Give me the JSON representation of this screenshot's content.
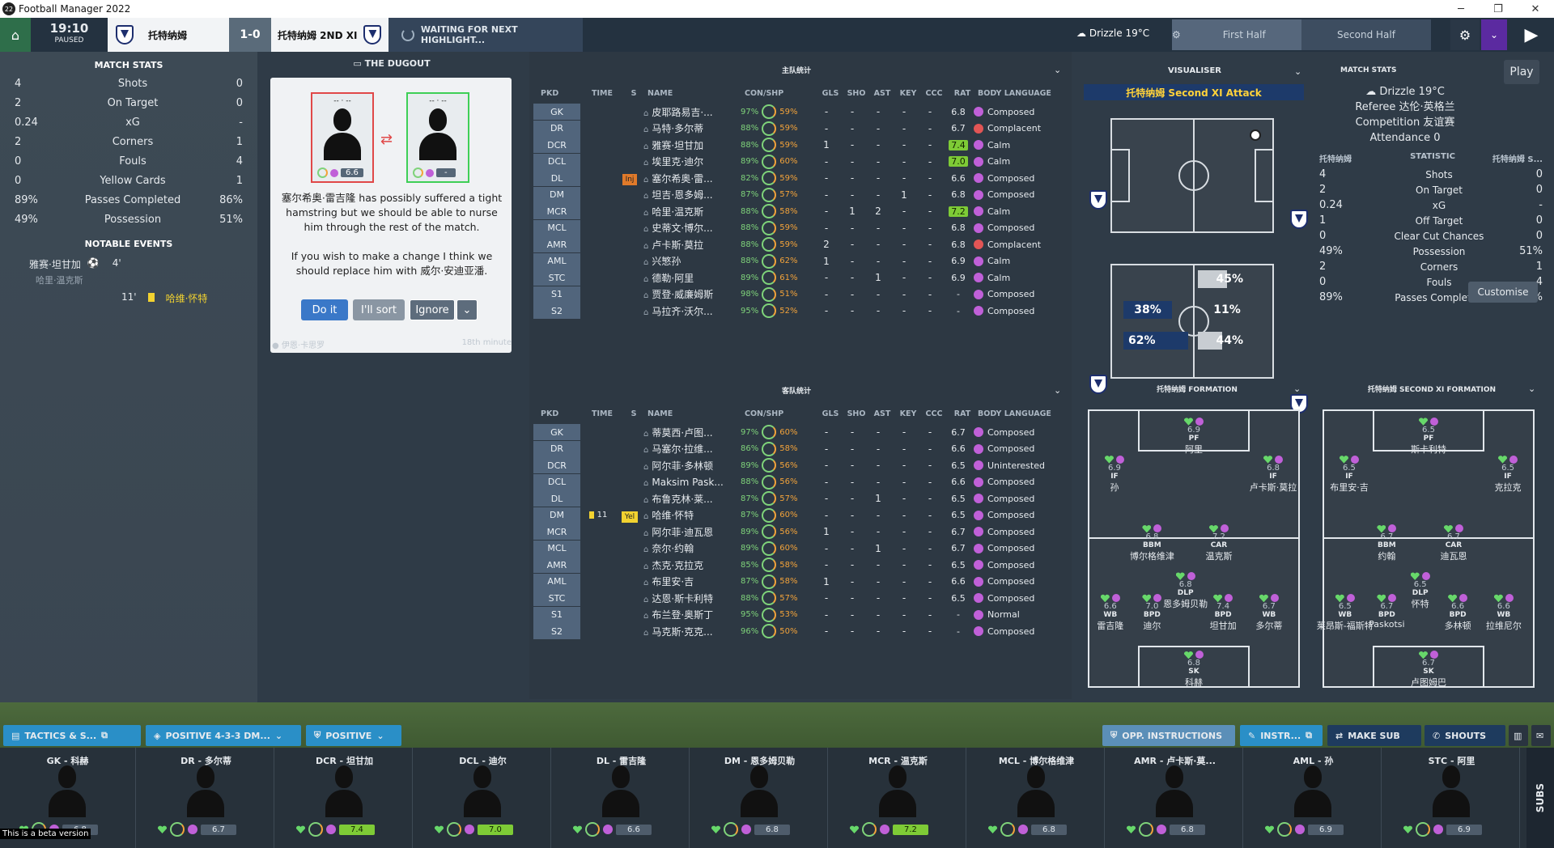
{
  "window": {
    "title": "Football Manager 2022",
    "logo": "22"
  },
  "header": {
    "time": "19:10",
    "status": "PAUSED",
    "home_team": "托特纳姆",
    "score": "1-0",
    "away_team": "托特纳姆 2ND XI",
    "waiting": "WAITING FOR NEXT HIGHLIGHT...",
    "weather": "Drizzle 19°C",
    "first_half": "First Half",
    "second_half": "Second Half"
  },
  "left_stats": {
    "title": "MATCH STATS",
    "rows": [
      {
        "a": "4",
        "label": "Shots",
        "b": "0"
      },
      {
        "a": "2",
        "label": "On Target",
        "b": "0"
      },
      {
        "a": "0.24",
        "label": "xG",
        "b": "-"
      },
      {
        "a": "2",
        "label": "Corners",
        "b": "1"
      },
      {
        "a": "0",
        "label": "Fouls",
        "b": "4"
      },
      {
        "a": "0",
        "label": "Yellow Cards",
        "b": "1"
      },
      {
        "a": "89%",
        "label": "Passes Completed",
        "b": "86%"
      },
      {
        "a": "49%",
        "label": "Possession",
        "b": "51%"
      }
    ],
    "events_title": "NOTABLE EVENTS",
    "event1_player": "雅赛·坦甘加",
    "event1_minute": "4'",
    "event1_assist": "哈里·温克斯",
    "event2_minute": "11'",
    "event2_player": "哈维·怀特"
  },
  "dugout": {
    "title": "THE DUGOUT",
    "tile1_rating": "6.6",
    "tile2_rating": "-",
    "message1": "塞尔希奥·雷吉隆 has possibly suffered a tight hamstring but we should be able to nurse him through the rest of the match.",
    "message2": "If you wish to make a change I think we should replace him with 威尔·安迪亚潘.",
    "do_it": "Do it",
    "ill_sort": "I'll sort",
    "ignore": "Ignore",
    "from": "伊恩·卡思罗",
    "minute": "18th minute"
  },
  "squad1": {
    "title": "主队统计",
    "headers": {
      "pkd": "PKD",
      "time": "TIME",
      "s": "S",
      "name": "NAME",
      "con": "CON/SHP",
      "gls": "GLS",
      "sho": "SHO",
      "ast": "AST",
      "key": "KEY",
      "ccc": "CCC",
      "rat": "RAT",
      "bl": "BODY LANGUAGE"
    },
    "rows": [
      {
        "pos": "GK",
        "name": "皮耶路易吉·...",
        "con": "97%",
        "shp": "59%",
        "gls": "-",
        "sho": "-",
        "ast": "-",
        "key": "-",
        "ccc": "-",
        "rat": "6.8",
        "bl": "Composed"
      },
      {
        "pos": "DR",
        "name": "马特·多尔蒂",
        "con": "88%",
        "shp": "59%",
        "gls": "-",
        "sho": "-",
        "ast": "-",
        "key": "-",
        "ccc": "-",
        "rat": "6.7",
        "bl": "Complacent"
      },
      {
        "pos": "DCR",
        "name": "雅赛·坦甘加",
        "con": "88%",
        "shp": "59%",
        "gls": "1",
        "sho": "-",
        "ast": "-",
        "key": "-",
        "ccc": "-",
        "rat": "7.4",
        "bl": "Calm"
      },
      {
        "pos": "DCL",
        "name": "埃里克·迪尔",
        "con": "89%",
        "shp": "60%",
        "gls": "-",
        "sho": "-",
        "ast": "-",
        "key": "-",
        "ccc": "-",
        "rat": "7.0",
        "bl": "Calm"
      },
      {
        "pos": "DL",
        "name": "塞尔希奥·雷...",
        "con": "82%",
        "shp": "59%",
        "gls": "-",
        "sho": "-",
        "ast": "-",
        "key": "-",
        "ccc": "-",
        "rat": "6.6",
        "bl": "Composed",
        "tag": "Inj"
      },
      {
        "pos": "DM",
        "name": "坦吉·恩多姆...",
        "con": "87%",
        "shp": "57%",
        "gls": "-",
        "sho": "-",
        "ast": "-",
        "key": "1",
        "ccc": "-",
        "rat": "6.8",
        "bl": "Composed"
      },
      {
        "pos": "MCR",
        "name": "哈里·温克斯",
        "con": "88%",
        "shp": "58%",
        "gls": "-",
        "sho": "1",
        "ast": "2",
        "key": "-",
        "ccc": "-",
        "rat": "7.2",
        "bl": "Calm"
      },
      {
        "pos": "MCL",
        "name": "史蒂文·博尔...",
        "con": "88%",
        "shp": "59%",
        "gls": "-",
        "sho": "-",
        "ast": "-",
        "key": "-",
        "ccc": "-",
        "rat": "6.8",
        "bl": "Composed"
      },
      {
        "pos": "AMR",
        "name": "卢卡斯·莫拉",
        "con": "88%",
        "shp": "59%",
        "gls": "2",
        "sho": "-",
        "ast": "-",
        "key": "-",
        "ccc": "-",
        "rat": "6.8",
        "bl": "Complacent"
      },
      {
        "pos": "AML",
        "name": "兴慜孙",
        "con": "88%",
        "shp": "62%",
        "gls": "1",
        "sho": "-",
        "ast": "-",
        "key": "-",
        "ccc": "-",
        "rat": "6.9",
        "bl": "Calm"
      },
      {
        "pos": "STC",
        "name": "德勒·阿里",
        "con": "89%",
        "shp": "61%",
        "gls": "-",
        "sho": "-",
        "ast": "1",
        "key": "-",
        "ccc": "-",
        "rat": "6.9",
        "bl": "Calm"
      },
      {
        "pos": "S1",
        "name": "贾登·威廉姆斯",
        "con": "98%",
        "shp": "51%",
        "gls": "-",
        "sho": "-",
        "ast": "-",
        "key": "-",
        "ccc": "-",
        "rat": "-",
        "bl": "Composed"
      },
      {
        "pos": "S2",
        "name": "马拉齐·沃尔...",
        "con": "95%",
        "shp": "52%",
        "gls": "-",
        "sho": "-",
        "ast": "-",
        "key": "-",
        "ccc": "-",
        "rat": "-",
        "bl": "Composed"
      }
    ]
  },
  "squad2": {
    "title": "客队统计",
    "rows": [
      {
        "pos": "GK",
        "name": "蒂莫西·卢图...",
        "con": "97%",
        "shp": "60%",
        "gls": "-",
        "sho": "-",
        "ast": "-",
        "key": "-",
        "ccc": "-",
        "rat": "6.7",
        "bl": "Composed"
      },
      {
        "pos": "DR",
        "name": "马塞尔·拉维...",
        "con": "86%",
        "shp": "58%",
        "gls": "-",
        "sho": "-",
        "ast": "-",
        "key": "-",
        "ccc": "-",
        "rat": "6.6",
        "bl": "Composed"
      },
      {
        "pos": "DCR",
        "name": "阿尔菲·多林顿",
        "con": "89%",
        "shp": "56%",
        "gls": "-",
        "sho": "-",
        "ast": "-",
        "key": "-",
        "ccc": "-",
        "rat": "6.5",
        "bl": "Uninterested"
      },
      {
        "pos": "DCL",
        "name": "Maksim Pask...",
        "con": "88%",
        "shp": "56%",
        "gls": "-",
        "sho": "-",
        "ast": "-",
        "key": "-",
        "ccc": "-",
        "rat": "6.6",
        "bl": "Composed"
      },
      {
        "pos": "DL",
        "name": "布鲁克林·莱...",
        "con": "87%",
        "shp": "57%",
        "gls": "-",
        "sho": "-",
        "ast": "1",
        "key": "-",
        "ccc": "-",
        "rat": "6.5",
        "bl": "Composed"
      },
      {
        "pos": "DM",
        "name": "哈维·怀特",
        "con": "87%",
        "shp": "60%",
        "gls": "-",
        "sho": "-",
        "ast": "-",
        "key": "-",
        "ccc": "-",
        "rat": "6.5",
        "bl": "Composed",
        "time": "11",
        "tag": "Yel"
      },
      {
        "pos": "MCR",
        "name": "阿尔菲·迪瓦恩",
        "con": "89%",
        "shp": "56%",
        "gls": "1",
        "sho": "-",
        "ast": "-",
        "key": "-",
        "ccc": "-",
        "rat": "6.7",
        "bl": "Composed"
      },
      {
        "pos": "MCL",
        "name": "奈尔·约翰",
        "con": "89%",
        "shp": "60%",
        "gls": "-",
        "sho": "-",
        "ast": "1",
        "key": "-",
        "ccc": "-",
        "rat": "6.7",
        "bl": "Composed"
      },
      {
        "pos": "AMR",
        "name": "杰克·克拉克",
        "con": "85%",
        "shp": "58%",
        "gls": "-",
        "sho": "-",
        "ast": "-",
        "key": "-",
        "ccc": "-",
        "rat": "6.5",
        "bl": "Composed"
      },
      {
        "pos": "AML",
        "name": "布里安·吉",
        "con": "87%",
        "shp": "58%",
        "gls": "1",
        "sho": "-",
        "ast": "-",
        "key": "-",
        "ccc": "-",
        "rat": "6.6",
        "bl": "Composed"
      },
      {
        "pos": "STC",
        "name": "达恩·斯卡利特",
        "con": "88%",
        "shp": "57%",
        "gls": "-",
        "sho": "-",
        "ast": "-",
        "key": "-",
        "ccc": "-",
        "rat": "6.5",
        "bl": "Composed"
      },
      {
        "pos": "S1",
        "name": "布兰登·奥斯丁",
        "con": "95%",
        "shp": "53%",
        "gls": "-",
        "sho": "-",
        "ast": "-",
        "key": "-",
        "ccc": "-",
        "rat": "-",
        "bl": "Normal"
      },
      {
        "pos": "S2",
        "name": "马克斯·克克...",
        "con": "96%",
        "shp": "50%",
        "gls": "-",
        "sho": "-",
        "ast": "-",
        "key": "-",
        "ccc": "-",
        "rat": "-",
        "bl": "Composed"
      }
    ]
  },
  "visualiser": {
    "title": "VISUALISER",
    "banner": "托特纳姆 Second XI Attack",
    "bar1": "45%",
    "bar2": "38%",
    "bar3": "11%",
    "bar4": "62%",
    "bar5": "44%"
  },
  "matchstats": {
    "title": "MATCH STATS",
    "play": "Play",
    "weather": "Drizzle 19°C",
    "referee": "Referee 达伦·英格兰",
    "competition": "Competition 友谊赛",
    "attendance": "Attendance 0",
    "col_home": "托特纳姆",
    "col_stat": "STATISTIC",
    "col_away": "托特纳姆 S...",
    "rows": [
      {
        "a": "4",
        "l": "Shots",
        "b": "0"
      },
      {
        "a": "2",
        "l": "On Target",
        "b": "0"
      },
      {
        "a": "0.24",
        "l": "xG",
        "b": "-"
      },
      {
        "a": "1",
        "l": "Off Target",
        "b": "0"
      },
      {
        "a": "0",
        "l": "Clear Cut Chances",
        "b": "0"
      },
      {
        "a": "49%",
        "l": "Possession",
        "b": "51%"
      },
      {
        "a": "2",
        "l": "Corners",
        "b": "1"
      },
      {
        "a": "0",
        "l": "Fouls",
        "b": "4"
      },
      {
        "a": "89%",
        "l": "Passes Completed",
        "b": "86%"
      }
    ],
    "customise": "Customise"
  },
  "formation1": {
    "title": "托特纳姆 FORMATION",
    "players": [
      {
        "name": "阿里",
        "role": "PF",
        "r": "6.9"
      },
      {
        "name": "孙",
        "role": "IF",
        "r": "6.9"
      },
      {
        "name": "卢卡斯·莫拉",
        "role": "IF",
        "r": "6.8"
      },
      {
        "name": "博尔格维津",
        "role": "BBM",
        "r": "6.8"
      },
      {
        "name": "温克斯",
        "role": "CAR",
        "r": "7.2"
      },
      {
        "name": "恩多姆贝勒",
        "role": "DLP",
        "r": "6.8"
      },
      {
        "name": "雷吉隆",
        "role": "WB",
        "r": "6.6"
      },
      {
        "name": "迪尔",
        "role": "BPD",
        "r": "7.0"
      },
      {
        "name": "坦甘加",
        "role": "BPD",
        "r": "7.4"
      },
      {
        "name": "多尔蒂",
        "role": "WB",
        "r": "6.7"
      },
      {
        "name": "科赫",
        "role": "SK",
        "r": "6.8"
      }
    ]
  },
  "formation2": {
    "title": "托特纳姆 SECOND XI FORMATION",
    "players": [
      {
        "name": "斯卡利特",
        "role": "PF",
        "r": "6.5"
      },
      {
        "name": "布里安·吉",
        "role": "IF",
        "r": "6.5"
      },
      {
        "name": "克拉克",
        "role": "IF",
        "r": "6.5"
      },
      {
        "name": "约翰",
        "role": "BBM",
        "r": "6.7"
      },
      {
        "name": "迪瓦恩",
        "role": "CAR",
        "r": "6.7"
      },
      {
        "name": "怀特",
        "role": "DLP",
        "r": "6.5"
      },
      {
        "name": "莱昂斯-福斯特",
        "role": "WB",
        "r": "6.5"
      },
      {
        "name": "Paskotsi",
        "role": "BPD",
        "r": "6.7"
      },
      {
        "name": "多林顿",
        "role": "BPD",
        "r": "6.6"
      },
      {
        "name": "拉维尼尔",
        "role": "WB",
        "r": "6.6"
      },
      {
        "name": "卢图姆巴",
        "role": "SK",
        "r": "6.7"
      }
    ]
  },
  "bottom": {
    "tactics": "TACTICS & S...",
    "formation": "POSITIVE 4-3-3 DM...",
    "mentality": "POSITIVE",
    "opp": "OPP. INSTRUCTIONS",
    "instr": "INSTR...",
    "makesub": "MAKE SUB",
    "shouts": "SHOUTS",
    "subs": "SUBS"
  },
  "pitchcards": [
    {
      "label": "GK - 科赫",
      "r": "6.8"
    },
    {
      "label": "DR - 多尔蒂",
      "r": "6.7"
    },
    {
      "label": "DCR - 坦甘加",
      "r": "7.4"
    },
    {
      "label": "DCL - 迪尔",
      "r": "7.0"
    },
    {
      "label": "DL - 雷吉隆",
      "r": "6.6"
    },
    {
      "label": "DM - 恩多姆贝勒",
      "r": "6.8"
    },
    {
      "label": "MCR - 温克斯",
      "r": "7.2"
    },
    {
      "label": "MCL - 博尔格维津",
      "r": "6.8"
    },
    {
      "label": "AMR - 卢卡斯·莫...",
      "r": "6.8"
    },
    {
      "label": "AML - 孙",
      "r": "6.9"
    },
    {
      "label": "STC - 阿里",
      "r": "6.9"
    }
  ],
  "beta": "This is a beta version"
}
